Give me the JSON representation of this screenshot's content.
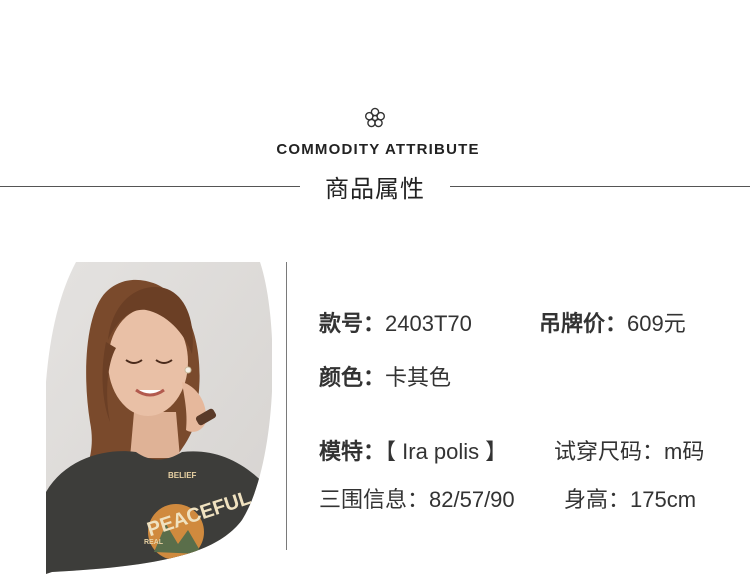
{
  "header": {
    "title_en": "COMMODITY ATTRIBUTE",
    "title_cn": "商品属性"
  },
  "attributes": {
    "style_no_label": "款号：",
    "style_no_value": "2403T70",
    "price_label": "吊牌价：",
    "price_value": "609元",
    "color_label": "颜色：",
    "color_value": "卡其色",
    "model_label": "模特：",
    "model_value": "【 Ira polis 】",
    "size_label": "试穿尺码：",
    "size_value": "m码",
    "measure_label": "三围信息：",
    "measure_value": "82/57/90",
    "height_label": "身高：",
    "height_value": "175cm"
  },
  "photo": {
    "shirt_print": {
      "line1": "BELIEF",
      "line2": "PEACEFUL",
      "line3": "REAL"
    }
  },
  "colors": {
    "text": "#333333",
    "rule": "#555555",
    "shirt": "#3d3d3a",
    "hair": "#7a4a2c",
    "skin": "#e9c0a6"
  }
}
